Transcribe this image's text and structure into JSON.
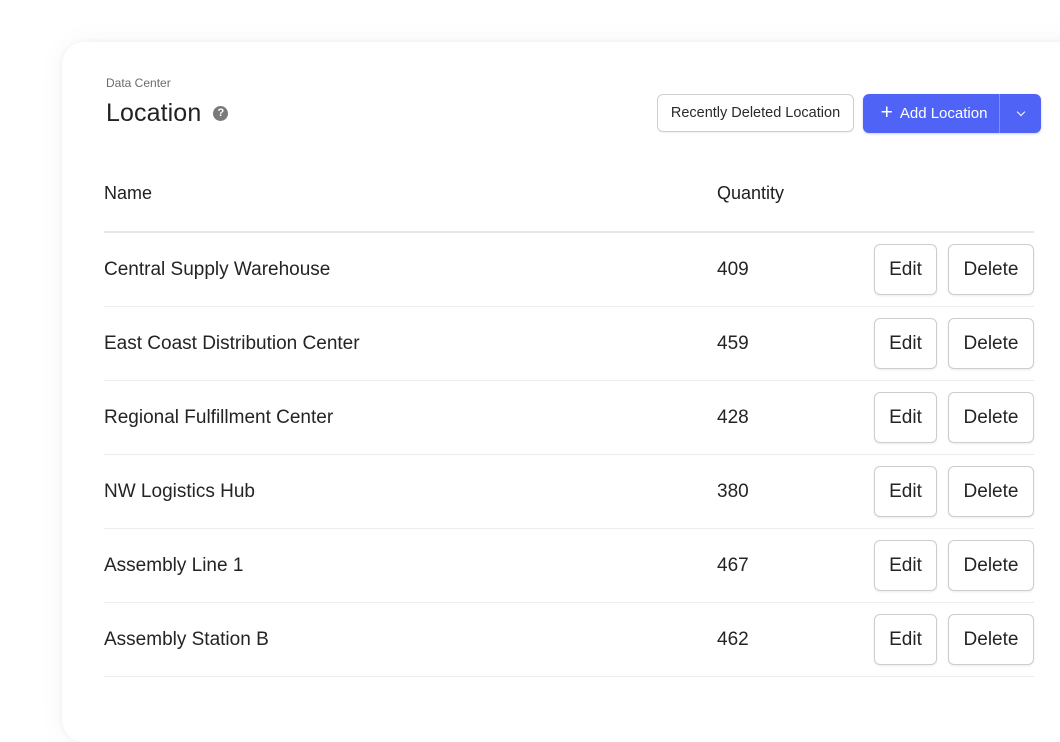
{
  "breadcrumb": "Data Center",
  "page_title": "Location",
  "help_icon_glyph": "?",
  "toolbar": {
    "recently_deleted_label": "Recently Deleted Location",
    "add_label": "Add Location",
    "add_icon": "plus-icon",
    "menu_icon": "chevron-down-icon"
  },
  "table": {
    "columns": [
      "Name",
      "Quantity"
    ],
    "edit_label": "Edit",
    "delete_label": "Delete",
    "rows": [
      {
        "name": "Central Supply Warehouse",
        "quantity": "409"
      },
      {
        "name": "East Coast Distribution Center",
        "quantity": "459"
      },
      {
        "name": "Regional Fulfillment Center",
        "quantity": "428"
      },
      {
        "name": "NW Logistics Hub",
        "quantity": "380"
      },
      {
        "name": "Assembly Line 1",
        "quantity": "467"
      },
      {
        "name": "Assembly Station B",
        "quantity": "462"
      }
    ]
  },
  "colors": {
    "accent": "#4f64f7",
    "text": "#242424",
    "border": "#cdcdcd"
  }
}
